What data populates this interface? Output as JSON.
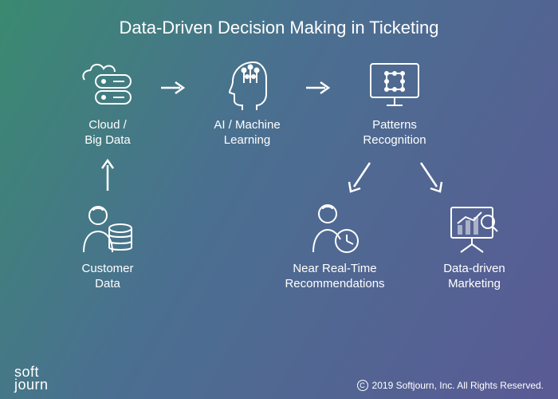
{
  "title": "Data-Driven Decision Making in Ticketing",
  "nodes": {
    "cloud": "Cloud /\nBig Data",
    "ai": "AI / Machine\nLearning",
    "patterns": "Patterns\nRecognition",
    "customer": "Customer\nData",
    "recs": "Near Real-Time\nRecommendations",
    "marketing": "Data-driven\nMarketing"
  },
  "footer": {
    "logo1": "soft",
    "logo2": "journ",
    "copyright_symbol": "C",
    "copyright": "2019 Softjourn, Inc. All Rights Reserved."
  }
}
